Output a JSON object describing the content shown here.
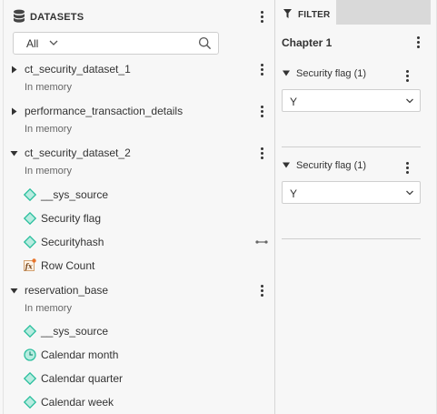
{
  "datasets_panel": {
    "title": "DATASETS",
    "filter_value": "All",
    "datasets": [
      {
        "name": "ct_security_dataset_1",
        "subtitle": "In memory",
        "expanded": false,
        "fields": []
      },
      {
        "name": "performance_transaction_details",
        "subtitle": "In memory",
        "expanded": false,
        "fields": []
      },
      {
        "name": "ct_security_dataset_2",
        "subtitle": "In memory",
        "expanded": true,
        "fields": [
          {
            "label": "__sys_source",
            "icon": "dimension-diamond-icon"
          },
          {
            "label": "Security flag",
            "icon": "dimension-diamond-icon"
          },
          {
            "label": "Securityhash",
            "icon": "dimension-diamond-icon",
            "badge_icon": "hash-link-icon"
          },
          {
            "label": "Row Count",
            "icon": "calculated-fx-icon"
          }
        ]
      },
      {
        "name": "reservation_base",
        "subtitle": "In memory",
        "expanded": true,
        "fields": [
          {
            "label": "__sys_source",
            "icon": "dimension-diamond-icon"
          },
          {
            "label": "Calendar month",
            "icon": "date-clock-icon"
          },
          {
            "label": "Calendar quarter",
            "icon": "dimension-diamond-icon"
          },
          {
            "label": "Calendar week",
            "icon": "dimension-diamond-icon"
          }
        ]
      }
    ]
  },
  "filter_panel": {
    "tab_label": "FILTER",
    "chapter": "Chapter 1",
    "filters": [
      {
        "label": "Security flag (1)",
        "value": "Y"
      },
      {
        "label": "Security flag (1)",
        "value": "Y"
      }
    ]
  },
  "colors": {
    "dimension_teal": "#2bbf9e",
    "panel_bg": "#f7f7f7",
    "tab_inactive": "#d9d9d9",
    "fx_orange": "#e8742b"
  }
}
